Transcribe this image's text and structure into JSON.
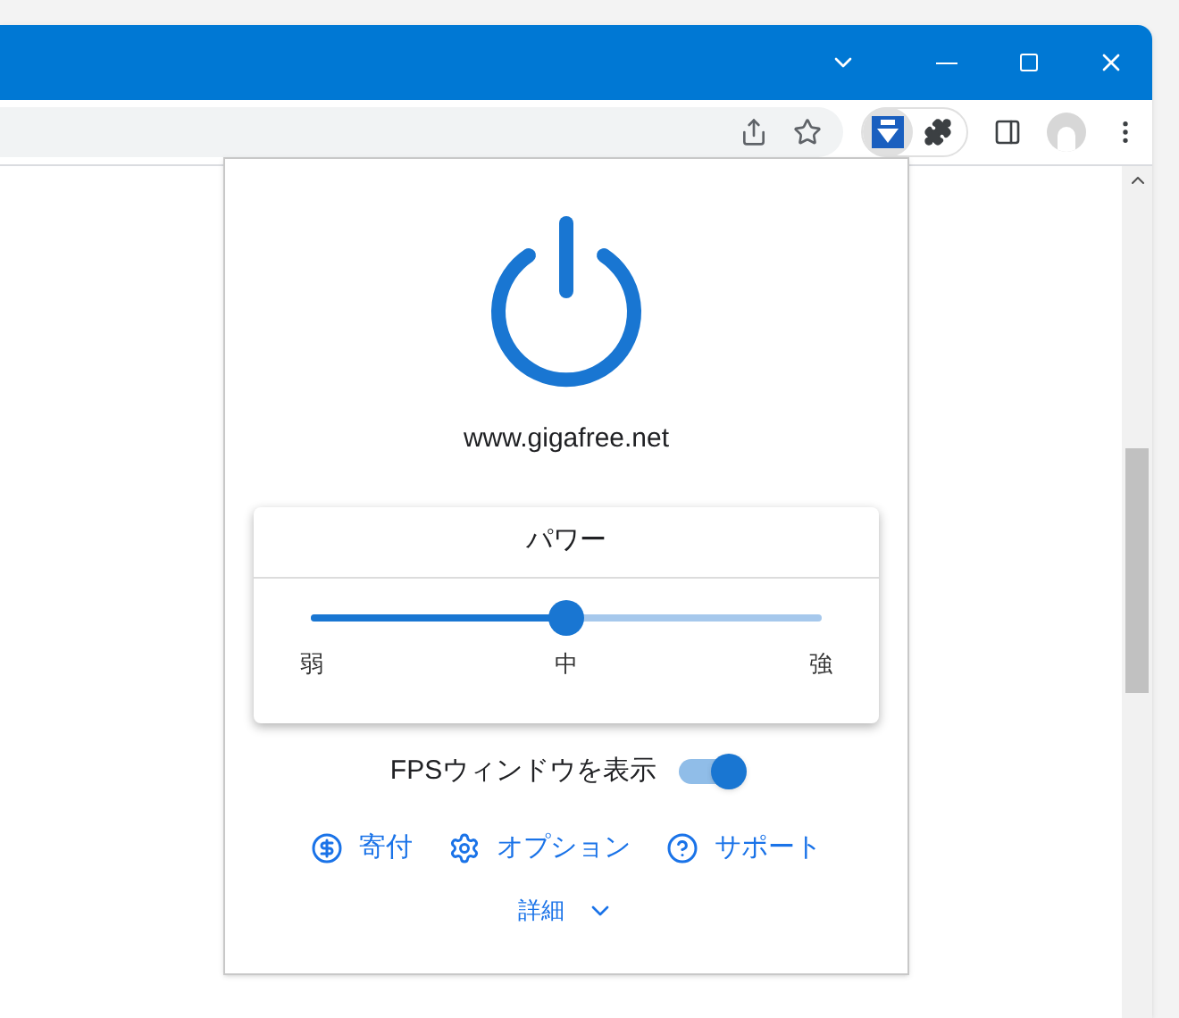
{
  "popup": {
    "site": "www.gigafree.net",
    "power": {
      "title": "パワー",
      "level": 0.5,
      "labels": [
        "弱",
        "中",
        "強"
      ]
    },
    "fps_toggle": {
      "label": "FPSウィンドウを表示",
      "on": true
    },
    "links": [
      {
        "kind": "donate",
        "label": "寄付"
      },
      {
        "kind": "options",
        "label": "オプション"
      },
      {
        "kind": "support",
        "label": "サポート"
      }
    ],
    "details": {
      "label": "詳細",
      "expanded": false
    }
  }
}
